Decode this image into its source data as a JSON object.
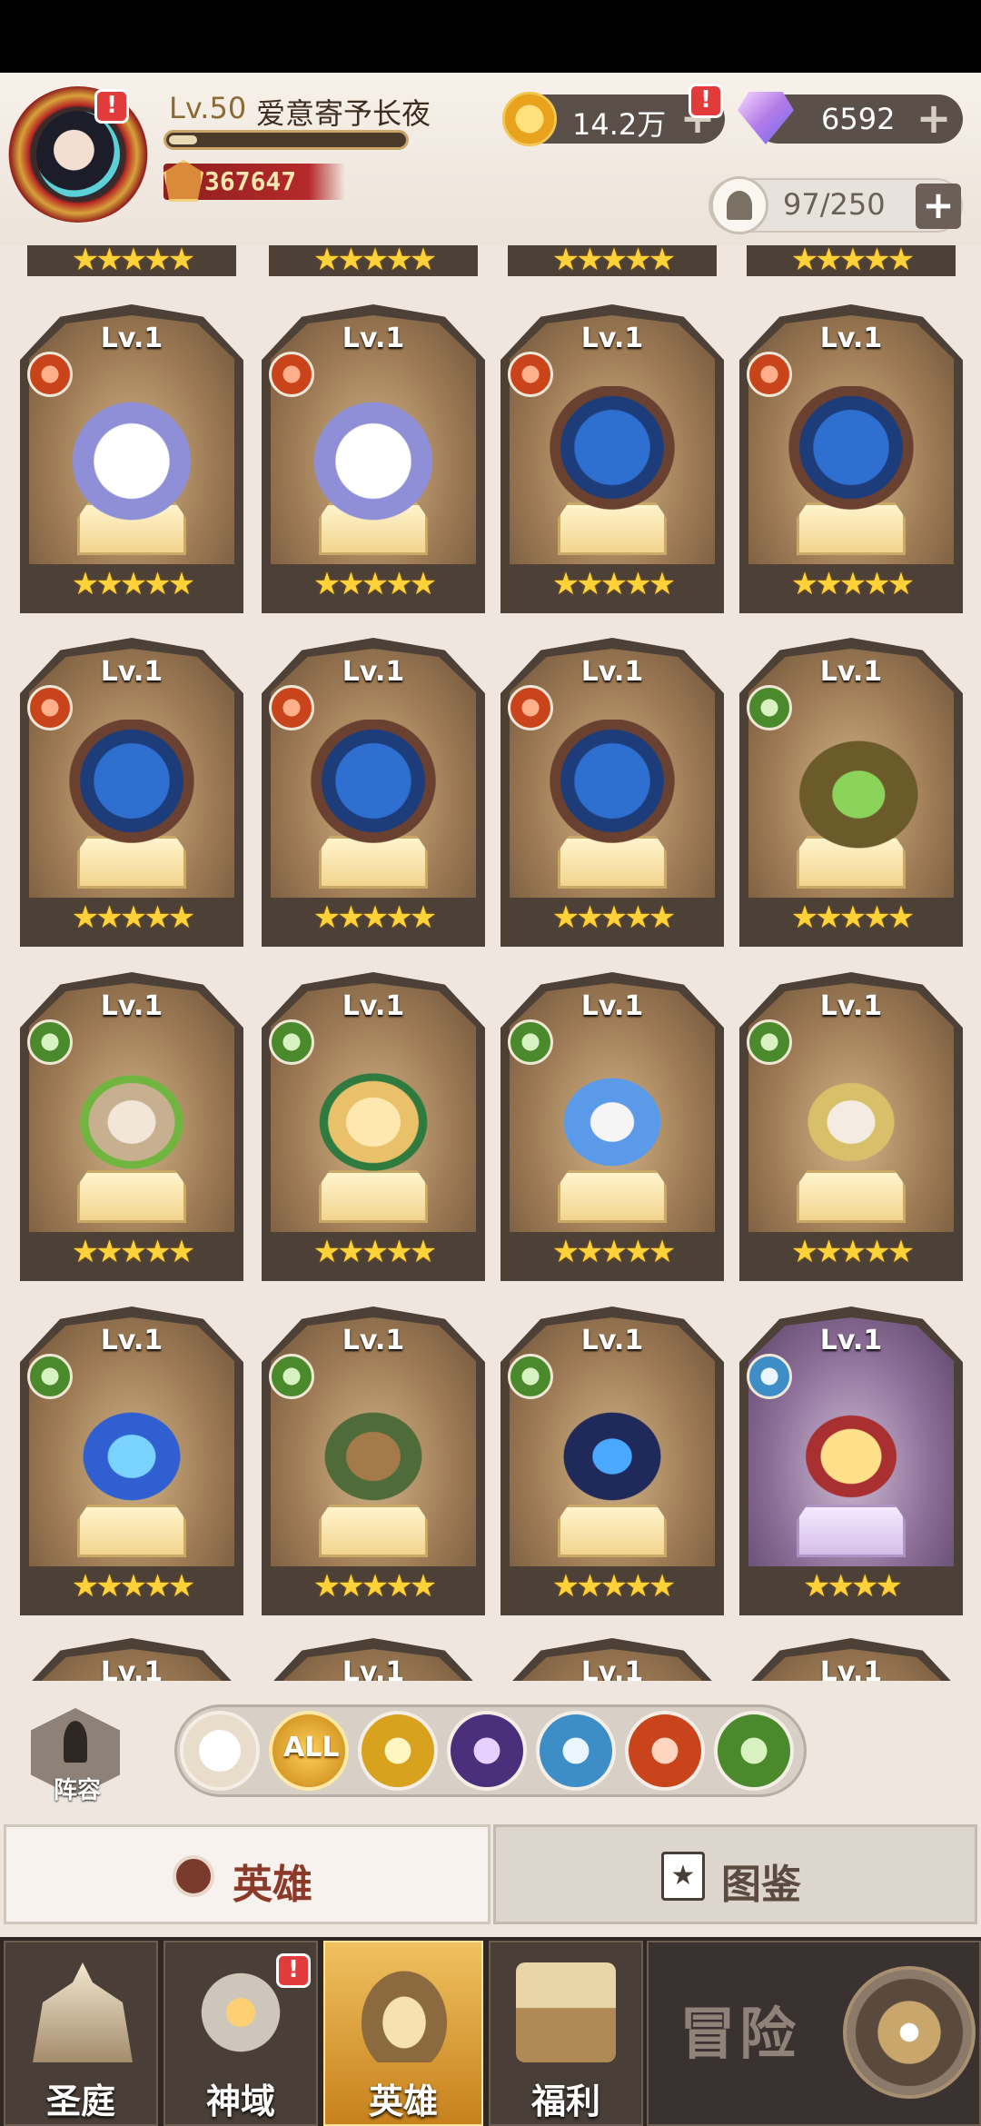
{
  "player": {
    "level_prefix": "Lv.50",
    "name": "爱意寄予长夜",
    "xp_fraction": 0.12,
    "power": "367647"
  },
  "resources": {
    "gold": "14.2万",
    "diamonds": "6592",
    "hero_capacity": "97/250"
  },
  "alerts": {
    "avatar": "!",
    "gold": "!",
    "divine_domain": "!"
  },
  "heroes": [
    {
      "level": "Lv.1",
      "faction": "beast",
      "stars": "★★★★★"
    },
    {
      "level": "Lv.1",
      "faction": "beast",
      "stars": "★★★★★"
    },
    {
      "level": "Lv.1",
      "faction": "beast",
      "stars": "★★★★★"
    },
    {
      "level": "Lv.1",
      "faction": "beast",
      "stars": "★★★★★"
    },
    {
      "level": "Lv.1",
      "faction": "beast",
      "stars": "★★★★★"
    },
    {
      "level": "Lv.1",
      "faction": "beast",
      "stars": "★★★★★"
    },
    {
      "level": "Lv.1",
      "faction": "beast",
      "stars": "★★★★★"
    },
    {
      "level": "Lv.1",
      "faction": "forest",
      "stars": "★★★★★"
    },
    {
      "level": "Lv.1",
      "faction": "forest",
      "stars": "★★★★★"
    },
    {
      "level": "Lv.1",
      "faction": "forest",
      "stars": "★★★★★"
    },
    {
      "level": "Lv.1",
      "faction": "forest",
      "stars": "★★★★★"
    },
    {
      "level": "Lv.1",
      "faction": "forest",
      "stars": "★★★★★"
    },
    {
      "level": "Lv.1",
      "faction": "forest",
      "stars": "★★★★★"
    },
    {
      "level": "Lv.1",
      "faction": "forest",
      "stars": "★★★★★"
    },
    {
      "level": "Lv.1",
      "faction": "forest",
      "stars": "★★★★★"
    },
    {
      "level": "Lv.1",
      "faction": "light",
      "stars": "★★★★"
    },
    {
      "level": "Lv.1"
    },
    {
      "level": "Lv.1"
    },
    {
      "level": "Lv.1"
    },
    {
      "level": "Lv.1"
    }
  ],
  "partial_top_stars": "★★★★★",
  "filters": {
    "lineup_label": "阵容",
    "all_label": "ALL",
    "icons": [
      "chevron-up-icon",
      "all-factions-icon",
      "sun-faction-icon",
      "dark-faction-icon",
      "light-faction-icon",
      "beast-faction-icon",
      "forest-faction-icon"
    ]
  },
  "tabs": {
    "heroes": "英雄",
    "codex": "图鉴"
  },
  "nav": {
    "sanctuary": "圣庭",
    "divine_domain": "神域",
    "heroes": "英雄",
    "benefits": "福利",
    "adventure": "冒险"
  }
}
